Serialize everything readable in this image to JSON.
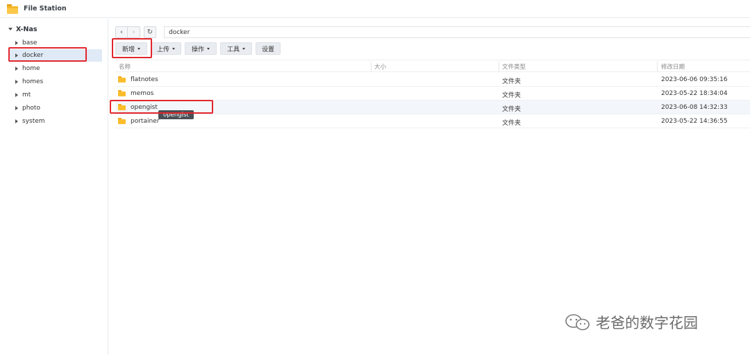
{
  "app": {
    "title": "File Station",
    "icon": "folder-icon"
  },
  "sidebar": {
    "root": "X-Nas",
    "items": [
      {
        "label": "base",
        "selected": false
      },
      {
        "label": "docker",
        "selected": true
      },
      {
        "label": "home",
        "selected": false
      },
      {
        "label": "homes",
        "selected": false
      },
      {
        "label": "mt",
        "selected": false
      },
      {
        "label": "photo",
        "selected": false
      },
      {
        "label": "system",
        "selected": false
      }
    ]
  },
  "navigation": {
    "back_icon": "chevron-left-icon",
    "forward_icon": "chevron-right-icon",
    "refresh_icon": "refresh-icon",
    "back_glyph": "‹",
    "forward_glyph": "›",
    "refresh_glyph": "↻",
    "path": "docker"
  },
  "toolbar": {
    "create": "新增",
    "upload": "上传",
    "action": "操作",
    "tools": "工具",
    "settings": "设置"
  },
  "table": {
    "columns": [
      "名称",
      "大小",
      "文件类型",
      "修改日期"
    ],
    "rows": [
      {
        "name": "flatnotes",
        "size": "",
        "type": "文件夹",
        "modified": "2023-06-06 09:35:16"
      },
      {
        "name": "memos",
        "size": "",
        "type": "文件夹",
        "modified": "2023-05-22 18:34:04"
      },
      {
        "name": "opengist",
        "size": "",
        "type": "文件夹",
        "modified": "2023-06-08 14:32:33"
      },
      {
        "name": "portainer",
        "size": "",
        "type": "文件夹",
        "modified": "2023-05-22 14:36:55"
      }
    ]
  },
  "tooltip": "opengist",
  "watermark": "老爸的数字花园",
  "colors": {
    "highlight": "#e3262d",
    "selected": "#dfeaf6",
    "folder": "#fbbd2c"
  }
}
